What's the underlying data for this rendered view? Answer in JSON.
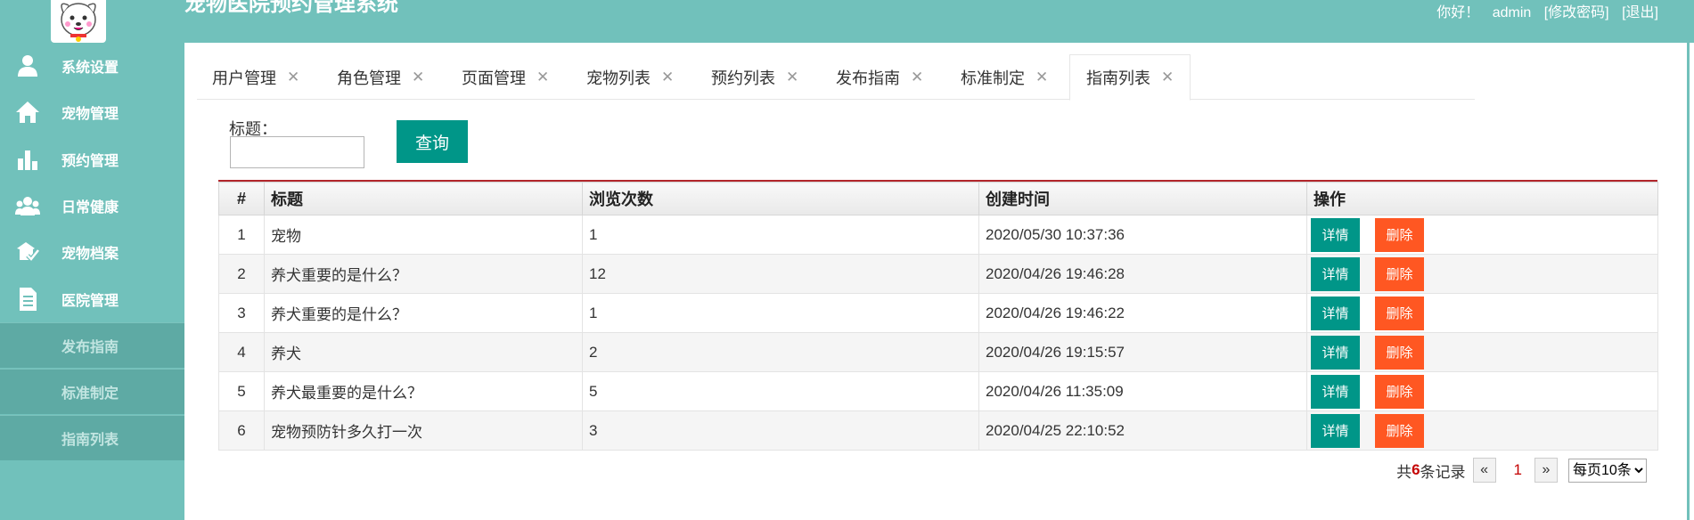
{
  "app": {
    "title": "宠物医院预约管理系统"
  },
  "header": {
    "greeting": "你好！",
    "username": "admin",
    "change_password": "[修改密码]",
    "logout": "[退出]"
  },
  "sidebar": {
    "menu": [
      {
        "label": "系统设置",
        "icon": "user-icon"
      },
      {
        "label": "宠物管理",
        "icon": "home-icon"
      },
      {
        "label": "预约管理",
        "icon": "bar-chart-icon"
      },
      {
        "label": "日常健康",
        "icon": "group-icon"
      },
      {
        "label": "宠物档案",
        "icon": "pet-check-icon"
      },
      {
        "label": "医院管理",
        "icon": "document-icon"
      }
    ],
    "sub_items": [
      {
        "label": "发布指南"
      },
      {
        "label": "标准制定"
      },
      {
        "label": "指南列表"
      }
    ]
  },
  "tabs": [
    {
      "label": "用户管理"
    },
    {
      "label": "角色管理"
    },
    {
      "label": "页面管理"
    },
    {
      "label": "宠物列表"
    },
    {
      "label": "预约列表"
    },
    {
      "label": "发布指南"
    },
    {
      "label": "标准制定"
    },
    {
      "label": "指南列表",
      "active": true
    }
  ],
  "tab_close_glyph": "✕",
  "search": {
    "label": "标题：",
    "value": "",
    "button": "查询"
  },
  "table": {
    "headers": [
      "#",
      "标题",
      "浏览次数",
      "创建时间",
      "操作"
    ],
    "rows": [
      {
        "num": "1",
        "title": "宠物",
        "views": "1",
        "created": "2020/05/30 10:37:36"
      },
      {
        "num": "2",
        "title": "养犬重要的是什么？",
        "views": "12",
        "created": "2020/04/26 19:46:28"
      },
      {
        "num": "3",
        "title": "养犬重要的是什么？",
        "views": "1",
        "created": "2020/04/26 19:46:22"
      },
      {
        "num": "4",
        "title": "养犬",
        "views": "2",
        "created": "2020/04/26 19:15:57"
      },
      {
        "num": "5",
        "title": "养犬最重要的是什么？",
        "views": "5",
        "created": "2020/04/26 11:35:09"
      },
      {
        "num": "6",
        "title": "宠物预防针多久打一次",
        "views": "3",
        "created": "2020/04/25 22:10:52"
      }
    ],
    "detail_label": "详情",
    "delete_label": "删除"
  },
  "pagination": {
    "prefix": "共",
    "total": "6",
    "suffix": "条记录",
    "prev": "«",
    "current_page": "1",
    "next": "»",
    "page_size_selected": "每页10条"
  },
  "colors": {
    "sidebar": "#71c1bb",
    "primary": "#009688",
    "danger": "#ff5722",
    "table_top_border": "#b2262b"
  }
}
